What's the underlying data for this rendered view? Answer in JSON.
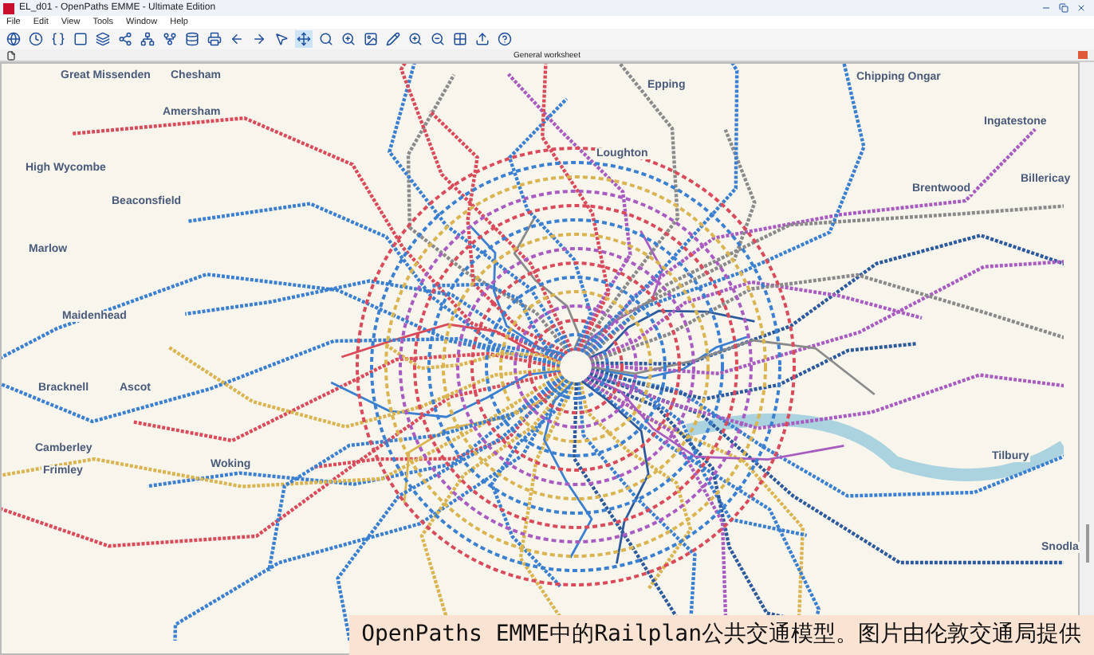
{
  "window": {
    "title": "EL_d01 - OpenPaths EMME - Ultimate Edition"
  },
  "menu": [
    "File",
    "Edit",
    "View",
    "Tools",
    "Window",
    "Help"
  ],
  "tabs": [
    {
      "label": "General worksheet",
      "selected": true
    }
  ],
  "map": {
    "labels": [
      "Great Missenden",
      "Chesham",
      "Amersham",
      "High Wycombe",
      "Beaconsfield",
      "Marlow",
      "Maidenhead",
      "Epping",
      "Chipping Ongar",
      "Ingatestone",
      "Brentwood",
      "Billericay",
      "Loughton",
      "Bracknell",
      "Ascot",
      "Camberley",
      "Frimley",
      "Woking",
      "Tilbury",
      "Snodla"
    ]
  },
  "caption": "OpenPaths EMME中的Railplan公共交通模型。图片由伦敦交通局提供"
}
